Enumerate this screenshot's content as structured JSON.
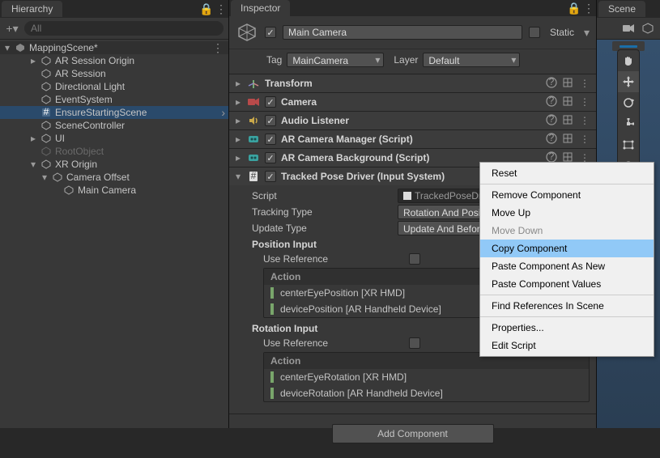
{
  "hierarchy": {
    "tab": "Hierarchy",
    "search_placeholder": "All",
    "scene_name": "MappingScene*",
    "items": [
      {
        "label": "AR Session Origin",
        "indent": 2
      },
      {
        "label": "AR Session",
        "indent": 2
      },
      {
        "label": "Directional Light",
        "indent": 2
      },
      {
        "label": "EventSystem",
        "indent": 2
      },
      {
        "label": "EnsureStartingScene",
        "indent": 2,
        "selected": true
      },
      {
        "label": "SceneController",
        "indent": 2
      },
      {
        "label": "UI",
        "indent": 2
      },
      {
        "label": "RootObject",
        "indent": 2,
        "dim": true
      },
      {
        "label": "XR Origin",
        "indent": 2,
        "expanded": true
      },
      {
        "label": "Camera Offset",
        "indent": 3,
        "expanded": true
      },
      {
        "label": "Main Camera",
        "indent": 4
      }
    ]
  },
  "inspector": {
    "tab": "Inspector",
    "name": "Main Camera",
    "static_label": "Static",
    "tag_label": "Tag",
    "tag_value": "MainCamera",
    "layer_label": "Layer",
    "layer_value": "Default",
    "components": [
      {
        "title": "Transform",
        "kind": "transform"
      },
      {
        "title": "Camera",
        "kind": "camera",
        "checkbox": true
      },
      {
        "title": "Audio Listener",
        "kind": "audio",
        "checkbox": true
      },
      {
        "title": "AR Camera Manager (Script)",
        "kind": "arscript",
        "checkbox": true
      },
      {
        "title": "AR Camera Background (Script)",
        "kind": "arscript",
        "checkbox": true
      },
      {
        "title": "Tracked Pose Driver (Input System)",
        "kind": "script",
        "checkbox": true,
        "expanded": true
      }
    ],
    "tracked_pose": {
      "script_label": "Script",
      "script_value": "TrackedPoseDriv",
      "tracking_type_label": "Tracking Type",
      "tracking_type_value": "Rotation And Positio",
      "update_type_label": "Update Type",
      "update_type_value": "Update And Before",
      "position_input_label": "Position Input",
      "use_reference_label": "Use Reference",
      "action_label": "Action",
      "position_actions": [
        "centerEyePosition [XR HMD]",
        "devicePosition [AR Handheld Device]"
      ],
      "rotation_input_label": "Rotation Input",
      "rotation_actions": [
        "centerEyeRotation [XR HMD]",
        "deviceRotation [AR Handheld Device]"
      ]
    },
    "add_component": "Add Component"
  },
  "scene": {
    "tab": "Scene"
  },
  "context_menu": {
    "items": [
      {
        "label": "Reset",
        "type": "item"
      },
      {
        "type": "sep"
      },
      {
        "label": "Remove Component",
        "type": "item"
      },
      {
        "label": "Move Up",
        "type": "item"
      },
      {
        "label": "Move Down",
        "type": "item",
        "disabled": true
      },
      {
        "label": "Copy Component",
        "type": "item",
        "hover": true
      },
      {
        "label": "Paste Component As New",
        "type": "item"
      },
      {
        "label": "Paste Component Values",
        "type": "item"
      },
      {
        "type": "sep"
      },
      {
        "label": "Find References In Scene",
        "type": "item"
      },
      {
        "type": "sep"
      },
      {
        "label": "Properties...",
        "type": "item"
      },
      {
        "label": "Edit Script",
        "type": "item"
      }
    ]
  }
}
